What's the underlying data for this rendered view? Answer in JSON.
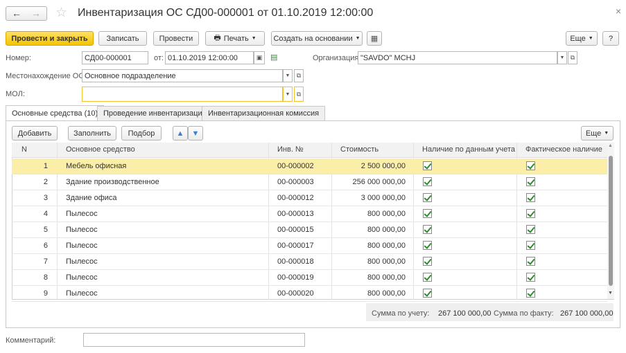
{
  "window": {
    "title": "Инвентаризация ОС СД00-000001 от 01.10.2019 12:00:00",
    "close": "×"
  },
  "toolbar": {
    "post_close": "Провести и закрыть",
    "save": "Записать",
    "post": "Провести",
    "print": "Печать",
    "create_based": "Создать на основании",
    "more": "Еще",
    "help": "?"
  },
  "form": {
    "number_label": "Номер:",
    "number": "СД00-000001",
    "date_label": "от:",
    "date": "01.10.2019 12:00:00",
    "org_label": "Организация:",
    "org": "\"SAVDO\" MCHJ",
    "location_label": "Местонахождение ОС:",
    "location": "Основное подразделение",
    "mol_label": "МОЛ:",
    "mol": "",
    "comment_label": "Комментарий:",
    "comment": ""
  },
  "tabs": [
    {
      "label": "Основные средства (10)"
    },
    {
      "label": "Проведение инвентаризации"
    },
    {
      "label": "Инвентаризационная комиссия"
    }
  ],
  "table_toolbar": {
    "add": "Добавить",
    "fill": "Заполнить",
    "select": "Подбор",
    "more": "Еще"
  },
  "table": {
    "columns": [
      "N",
      "Основное средство",
      "Инв. №",
      "Стоимость",
      "Наличие по данным учета",
      "Фактическое наличие"
    ],
    "rows": [
      {
        "n": "1",
        "asset": "Мебель офисная",
        "inv": "00-000002",
        "cost": "2 500 000,00",
        "book": true,
        "actual": true
      },
      {
        "n": "2",
        "asset": "Здание производственное",
        "inv": "00-000003",
        "cost": "256 000 000,00",
        "book": true,
        "actual": true
      },
      {
        "n": "3",
        "asset": "Здание офиса",
        "inv": "00-000012",
        "cost": "3 000 000,00",
        "book": true,
        "actual": true
      },
      {
        "n": "4",
        "asset": "Пылесос",
        "inv": "00-000013",
        "cost": "800 000,00",
        "book": true,
        "actual": true
      },
      {
        "n": "5",
        "asset": "Пылесос",
        "inv": "00-000015",
        "cost": "800 000,00",
        "book": true,
        "actual": true
      },
      {
        "n": "6",
        "asset": "Пылесос",
        "inv": "00-000017",
        "cost": "800 000,00",
        "book": true,
        "actual": true
      },
      {
        "n": "7",
        "asset": "Пылесос",
        "inv": "00-000018",
        "cost": "800 000,00",
        "book": true,
        "actual": true
      },
      {
        "n": "8",
        "asset": "Пылесос",
        "inv": "00-000019",
        "cost": "800 000,00",
        "book": true,
        "actual": true
      },
      {
        "n": "9",
        "asset": "Пылесос",
        "inv": "00-000020",
        "cost": "800 000,00",
        "book": true,
        "actual": true
      }
    ]
  },
  "totals": {
    "book_label": "Сумма по учету:",
    "book_value": "267 100 000,00",
    "actual_label": "Сумма по факту:",
    "actual_value": "267 100 000,00"
  },
  "colors": {
    "accent": "#f5c400",
    "selected_row": "#fbeea8",
    "check": "#2e8b2e"
  }
}
